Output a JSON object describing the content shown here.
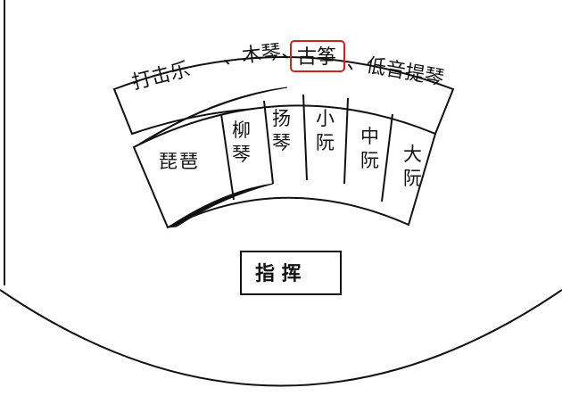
{
  "colors": {
    "ink": "#111111",
    "highlight": "#cc2222",
    "background": "#ffffff"
  },
  "outer_arc": {
    "segments": [
      {
        "text": "打击乐"
      },
      {
        "text": "、木琴、"
      },
      {
        "text": "古筝",
        "highlighted": true
      },
      {
        "text": "、低音提琴"
      }
    ]
  },
  "seats": [
    "琵琶",
    "柳琴",
    "扬琴",
    "小阮",
    "中阮",
    "大阮"
  ],
  "conductor": "指 挥"
}
